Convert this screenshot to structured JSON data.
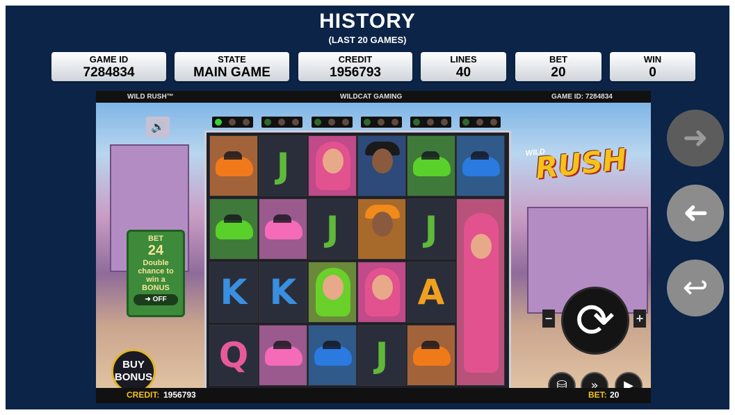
{
  "history": {
    "title": "HISTORY",
    "subtitle": "(LAST 20 GAMES)",
    "stats": [
      {
        "label": "GAME ID",
        "value": "7284834"
      },
      {
        "label": "STATE",
        "value": "MAIN GAME"
      },
      {
        "label": "CREDIT",
        "value": "1956793"
      },
      {
        "label": "LINES",
        "value": "40"
      },
      {
        "label": "BET",
        "value": "20"
      },
      {
        "label": "WIN",
        "value": "0"
      }
    ]
  },
  "game": {
    "name": "WILD RUSH™",
    "provider": "WILDCAT GAMING",
    "game_id_label": "GAME ID: 7284834",
    "credit_label": "CREDIT:",
    "credit_value": "1956793",
    "bet_label": "BET:",
    "bet_value": "20",
    "logo_small": "WILD",
    "logo_big": "RUSH",
    "bet_box": {
      "title": "BET",
      "value": "24",
      "line1": "Double",
      "line2": "chance to",
      "line3": "win a",
      "line4": "BONUS",
      "toggle": "OFF"
    },
    "buy_bonus": {
      "line1": "BUY",
      "line2": "BONUS"
    },
    "reels": [
      [
        "car-orange",
        "car-green",
        "K",
        "Q"
      ],
      [
        "J",
        "car-pink",
        "K",
        "car-pink"
      ],
      [
        "girl-pink",
        "J",
        "girl-green",
        "car-blue"
      ],
      [
        "man-cap",
        "man-orange",
        "girl-pink",
        "J"
      ],
      [
        "car-green",
        "J",
        "A",
        "car-orange"
      ],
      [
        "car-blue",
        "girl-pink-tall",
        "girl-pink-tall",
        "girl-pink-tall"
      ]
    ]
  },
  "colors": {
    "frame": "#0b2447",
    "J": "#5fb83a",
    "K": "#3a8fe0",
    "A": "#f0a020",
    "Q": "#e75a9a"
  },
  "icons": {
    "next": "arrow-right-icon",
    "prev": "arrow-left-icon",
    "back": "return-icon",
    "spin": "refresh-icon"
  }
}
